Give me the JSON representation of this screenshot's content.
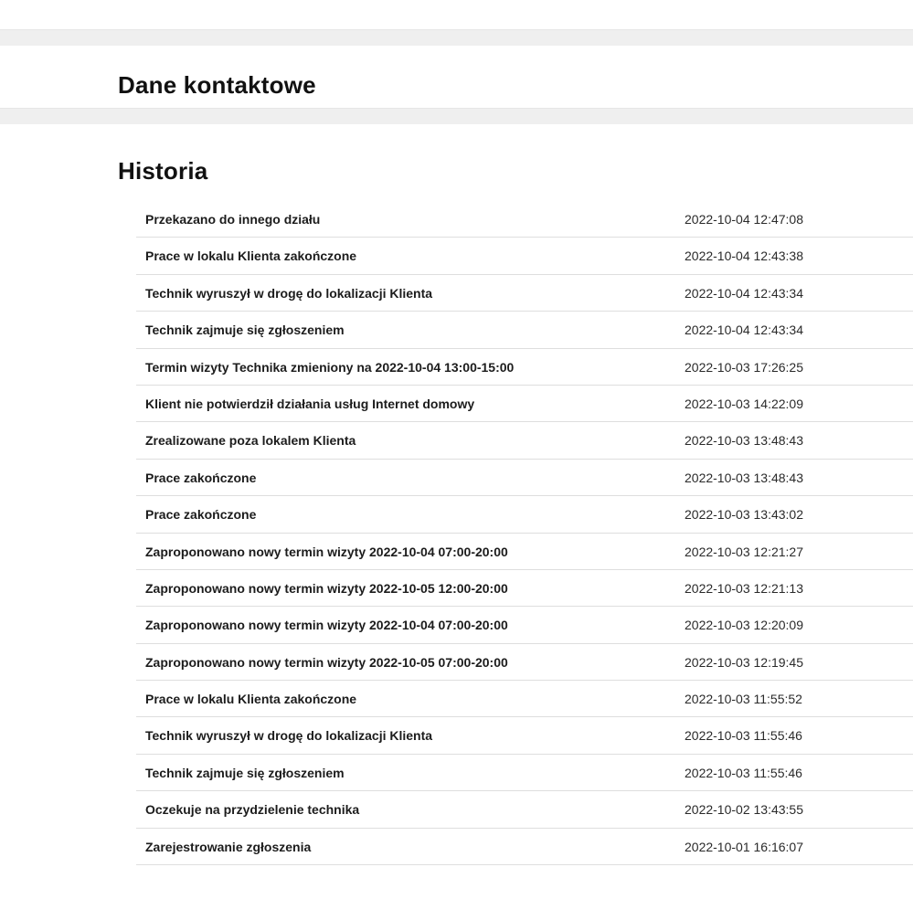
{
  "sections": {
    "contact_title": "Dane kontaktowe",
    "history_title": "Historia"
  },
  "history": [
    {
      "event": "Przekazano do innego działu",
      "date": "2022-10-04 12:47:08"
    },
    {
      "event": "Prace w lokalu Klienta zakończone",
      "date": "2022-10-04 12:43:38"
    },
    {
      "event": "Technik wyruszył w drogę do lokalizacji Klienta",
      "date": "2022-10-04 12:43:34"
    },
    {
      "event": "Technik zajmuje się zgłoszeniem",
      "date": "2022-10-04 12:43:34"
    },
    {
      "event": "Termin wizyty Technika zmieniony na 2022-10-04 13:00-15:00",
      "date": "2022-10-03 17:26:25"
    },
    {
      "event": "Klient nie potwierdził działania usług Internet domowy",
      "date": "2022-10-03 14:22:09"
    },
    {
      "event": "Zrealizowane poza lokalem Klienta",
      "date": "2022-10-03 13:48:43"
    },
    {
      "event": "Prace zakończone",
      "date": "2022-10-03 13:48:43"
    },
    {
      "event": "Prace zakończone",
      "date": "2022-10-03 13:43:02"
    },
    {
      "event": "Zaproponowano nowy termin wizyty 2022-10-04 07:00-20:00",
      "date": "2022-10-03 12:21:27"
    },
    {
      "event": "Zaproponowano nowy termin wizyty 2022-10-05 12:00-20:00",
      "date": "2022-10-03 12:21:13"
    },
    {
      "event": "Zaproponowano nowy termin wizyty 2022-10-04 07:00-20:00",
      "date": "2022-10-03 12:20:09"
    },
    {
      "event": "Zaproponowano nowy termin wizyty 2022-10-05 07:00-20:00",
      "date": "2022-10-03 12:19:45"
    },
    {
      "event": "Prace w lokalu Klienta zakończone",
      "date": "2022-10-03 11:55:52"
    },
    {
      "event": "Technik wyruszył w drogę do lokalizacji Klienta",
      "date": "2022-10-03 11:55:46"
    },
    {
      "event": "Technik zajmuje się zgłoszeniem",
      "date": "2022-10-03 11:55:46"
    },
    {
      "event": "Oczekuje na przydzielenie technika",
      "date": "2022-10-02 13:43:55"
    },
    {
      "event": "Zarejestrowanie zgłoszenia",
      "date": "2022-10-01 16:16:07"
    }
  ]
}
